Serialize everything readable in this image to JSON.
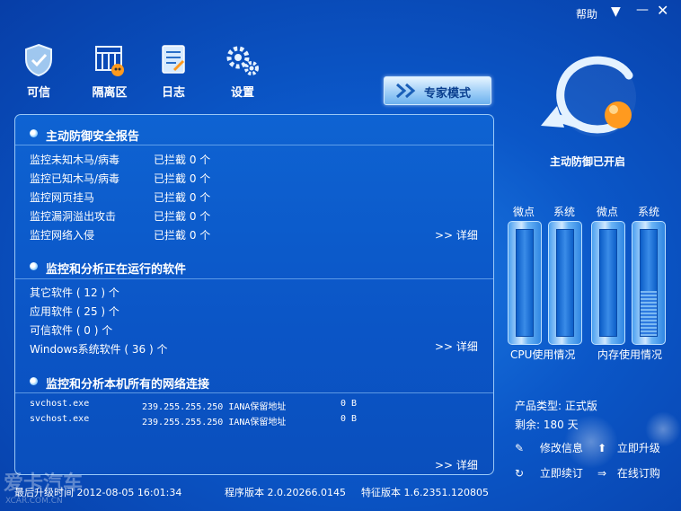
{
  "titlebar": {
    "help_label": "帮助"
  },
  "toolbar": {
    "items": [
      {
        "label": "可信",
        "icon": "shield-check-icon"
      },
      {
        "label": "隔离区",
        "icon": "quarantine-icon"
      },
      {
        "label": "日志",
        "icon": "log-notebook-icon"
      },
      {
        "label": "设置",
        "icon": "gears-icon"
      }
    ],
    "expert_mode_label": "专家模式"
  },
  "status": {
    "protection_label": "主动防御已开启"
  },
  "report": {
    "title": "主动防御安全报告",
    "rows": [
      {
        "name": "监控未知木马/病毒",
        "value": "已拦截 0 个"
      },
      {
        "name": "监控已知木马/病毒",
        "value": "已拦截 0 个"
      },
      {
        "name": "监控网页挂马",
        "value": "已拦截 0 个"
      },
      {
        "name": "监控漏洞溢出攻击",
        "value": "已拦截 0 个"
      },
      {
        "name": "监控网络入侵",
        "value": "已拦截 0 个"
      }
    ],
    "detail_label": ">> 详细"
  },
  "software": {
    "title": "监控和分析正在运行的软件",
    "rows": [
      "其它软件 ( 12 ) 个",
      "应用软件 ( 25 ) 个",
      "可信软件 ( 0 ) 个",
      "Windows系统软件 ( 36 ) 个"
    ],
    "detail_label": ">> 详细"
  },
  "network": {
    "title": "监控和分析本机所有的网络连接",
    "rows": [
      {
        "process": "svchost.exe",
        "address": "239.255.255.250 IANA保留地址",
        "bytes": "0 B"
      },
      {
        "process": "svchost.exe",
        "address": "239.255.255.250 IANA保留地址",
        "bytes": "0 B"
      }
    ],
    "detail_label": ">> 详细"
  },
  "gauges": {
    "labels": [
      "微点",
      "系统",
      "微点",
      "系统"
    ],
    "levels": [
      0.0,
      0.0,
      0.0,
      0.42
    ],
    "cpu_label": "CPU使用情况",
    "mem_label": "内存使用情况"
  },
  "product": {
    "type_text": "产品类型: 正式版",
    "remaining_text": "剩余: 180 天",
    "links": {
      "modify_info": "修改信息",
      "upgrade_now": "立即升级",
      "renew_now": "立即续订",
      "online_order": "在线订购"
    }
  },
  "footer": {
    "last_upgrade": "最后升级时间 2012-08-05 16:01:34",
    "program_version": "程序版本 2.0.20266.0145",
    "signature_version": "特征版本 1.6.2351.120805"
  },
  "watermark": {
    "brand": "爱卡汽车",
    "site": "XCAR.COM.CN"
  },
  "colors": {
    "accent_orange": "#ff9a1f",
    "panel_blue": "#0b57c8",
    "border_light": "#b4dcff"
  }
}
